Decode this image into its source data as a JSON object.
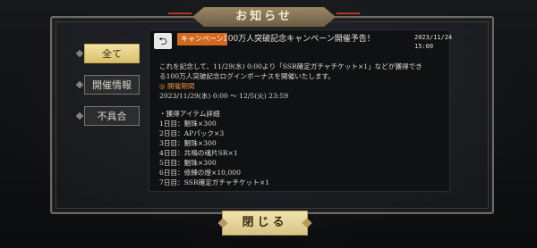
{
  "header": {
    "title": "お知らせ"
  },
  "tabs": [
    {
      "label": "全て",
      "active": true
    },
    {
      "label": "開催情報",
      "active": false
    },
    {
      "label": "不具合",
      "active": false
    }
  ],
  "news": {
    "back_icon": "return-arrow-icon",
    "badge": "キャンペーン",
    "title": "100万人突破記念キャンペーン開催予告！",
    "date": "2023/11/24",
    "time": "15:00",
    "intro_line1": "これを記念して、11/29(水) 0:00より「SSR確定ガチャチケット×1」などが獲得でき",
    "intro_line2": "る100万人突破記念ログインボーナスを開催いたします。",
    "period_heading": "◎ 開催期間",
    "period": "2023/11/29(水) 0:00 ～ 12/5(火) 23:59",
    "items_heading": "・獲得アイテム詳細",
    "items": [
      "1日目：魍珠×300",
      "2日目：APパック×3",
      "3日目：魍珠×300",
      "4日目：共鳴の魂片SR×1",
      "5日目：魍珠×300",
      "6日目：修練の燈×10,000",
      "7日目：SSR確定ガチャチケット×1"
    ]
  },
  "footer": {
    "close_label": "閉じる"
  },
  "colors": {
    "accent_gold": "#d9bf6a",
    "badge_orange": "#d2691e",
    "header_red": "#b9332c",
    "section_orange": "#e28a46"
  }
}
